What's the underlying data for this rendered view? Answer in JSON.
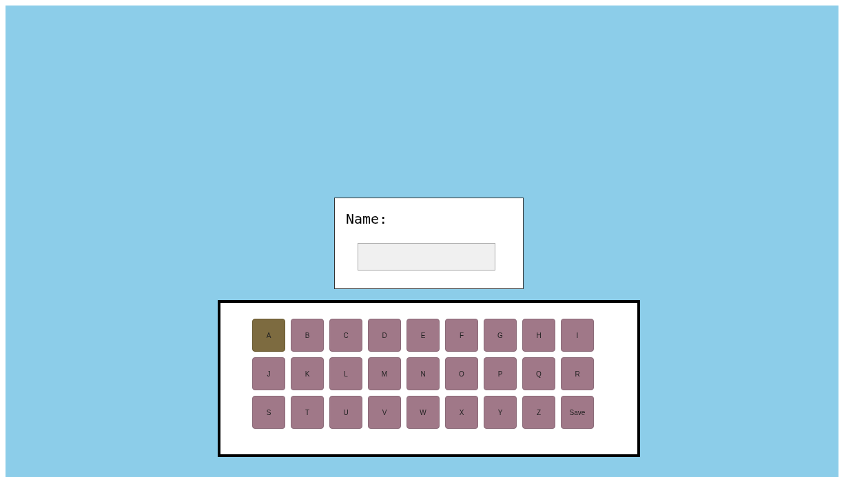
{
  "name_form": {
    "label": "Name:"
  },
  "keyboard": {
    "keys": [
      {
        "label": "A",
        "selected": true
      },
      {
        "label": "B",
        "selected": false
      },
      {
        "label": "C",
        "selected": false
      },
      {
        "label": "D",
        "selected": false
      },
      {
        "label": "E",
        "selected": false
      },
      {
        "label": "F",
        "selected": false
      },
      {
        "label": "G",
        "selected": false
      },
      {
        "label": "H",
        "selected": false
      },
      {
        "label": "I",
        "selected": false
      },
      {
        "label": "J",
        "selected": false
      },
      {
        "label": "K",
        "selected": false
      },
      {
        "label": "L",
        "selected": false
      },
      {
        "label": "M",
        "selected": false
      },
      {
        "label": "N",
        "selected": false
      },
      {
        "label": "O",
        "selected": false
      },
      {
        "label": "P",
        "selected": false
      },
      {
        "label": "Q",
        "selected": false
      },
      {
        "label": "R",
        "selected": false
      },
      {
        "label": "S",
        "selected": false
      },
      {
        "label": "T",
        "selected": false
      },
      {
        "label": "U",
        "selected": false
      },
      {
        "label": "V",
        "selected": false
      },
      {
        "label": "W",
        "selected": false
      },
      {
        "label": "X",
        "selected": false
      },
      {
        "label": "Y",
        "selected": false
      },
      {
        "label": "Z",
        "selected": false
      },
      {
        "label": "Save",
        "selected": false
      }
    ]
  }
}
